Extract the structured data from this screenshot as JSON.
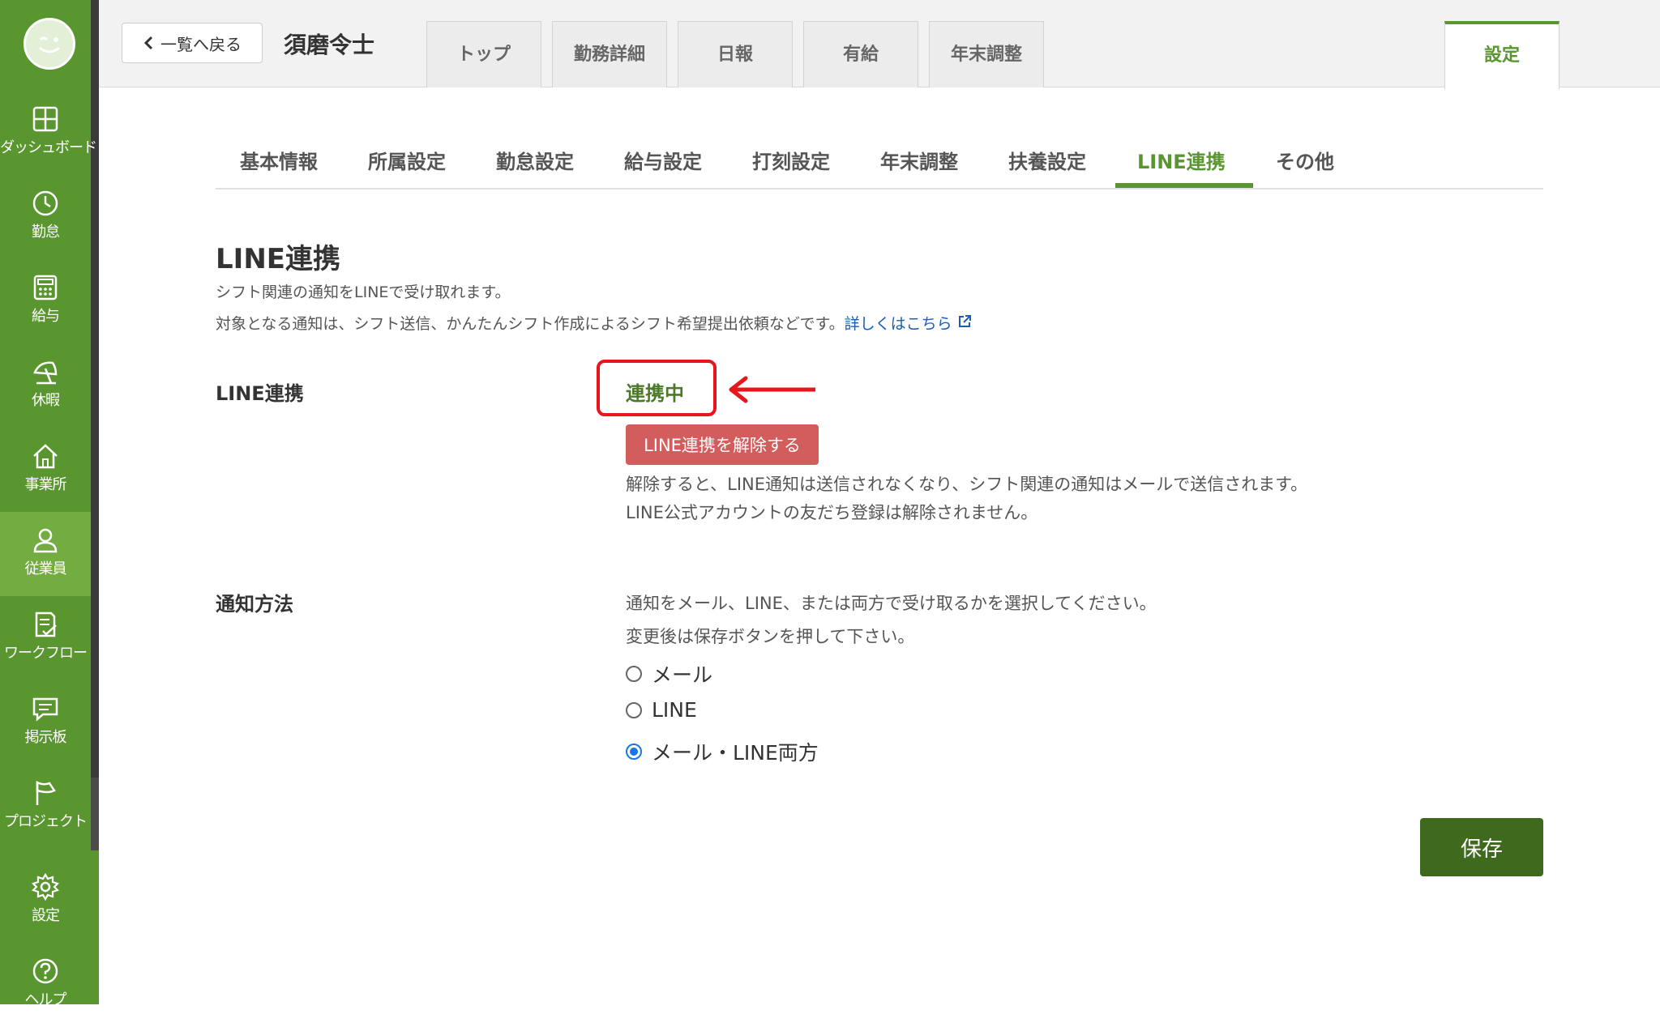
{
  "sidebar": {
    "items": [
      {
        "label": "ダッシュボード",
        "icon": "dashboard-icon"
      },
      {
        "label": "勤怠",
        "icon": "clock-icon"
      },
      {
        "label": "給与",
        "icon": "calculator-icon"
      },
      {
        "label": "休暇",
        "icon": "beach-umbrella-icon"
      },
      {
        "label": "事業所",
        "icon": "home-icon"
      },
      {
        "label": "従業員",
        "icon": "person-icon"
      },
      {
        "label": "ワークフロー",
        "icon": "checklist-icon"
      },
      {
        "label": "掲示板",
        "icon": "chat-icon"
      },
      {
        "label": "プロジェクト",
        "icon": "flag-icon"
      },
      {
        "label": "設定",
        "icon": "gear-icon"
      },
      {
        "label": "ヘルプ",
        "icon": "help-icon"
      }
    ],
    "active": "従業員"
  },
  "header": {
    "back_label": "一覧へ戻る",
    "employee_name": "須磨令士",
    "tabs": [
      "トップ",
      "勤務詳細",
      "日報",
      "有給",
      "年末調整",
      "設定"
    ],
    "active_tab": "設定"
  },
  "subtabs": {
    "items": [
      "基本情報",
      "所属設定",
      "勤怠設定",
      "給与設定",
      "打刻設定",
      "年末調整",
      "扶養設定",
      "LINE連携",
      "その他"
    ],
    "active": "LINE連携"
  },
  "page": {
    "title": "LINE連携",
    "desc1": "シフト関連の通知をLINEで受け取れます。",
    "desc2": "対象となる通知は、シフト送信、かんたんシフト作成によるシフト希望提出依頼などです。",
    "link": "詳しくはこちら"
  },
  "line": {
    "label": "LINE連携",
    "status": "連携中",
    "unlink_button": "LINE連携を解除する",
    "note1": "解除すると、LINE通知は送信されなくなり、シフト関連の通知はメールで送信されます。",
    "note2": "LINE公式アカウントの友だち登録は解除されません。"
  },
  "notify": {
    "label": "通知方法",
    "desc1": "通知をメール、LINE、または両方で受け取るかを選択してください。",
    "desc2": "変更後は保存ボタンを押して下さい。",
    "options": [
      "メール",
      "LINE",
      "メール・LINE両方"
    ],
    "selected": "メール・LINE両方"
  },
  "save_label": "保存",
  "colors": {
    "brand": "#5a9630",
    "active_nav": "#73ad42",
    "save": "#3f6a1e",
    "danger": "#d35d5d",
    "highlight": "#e8161b",
    "link": "#1a5fb4"
  }
}
